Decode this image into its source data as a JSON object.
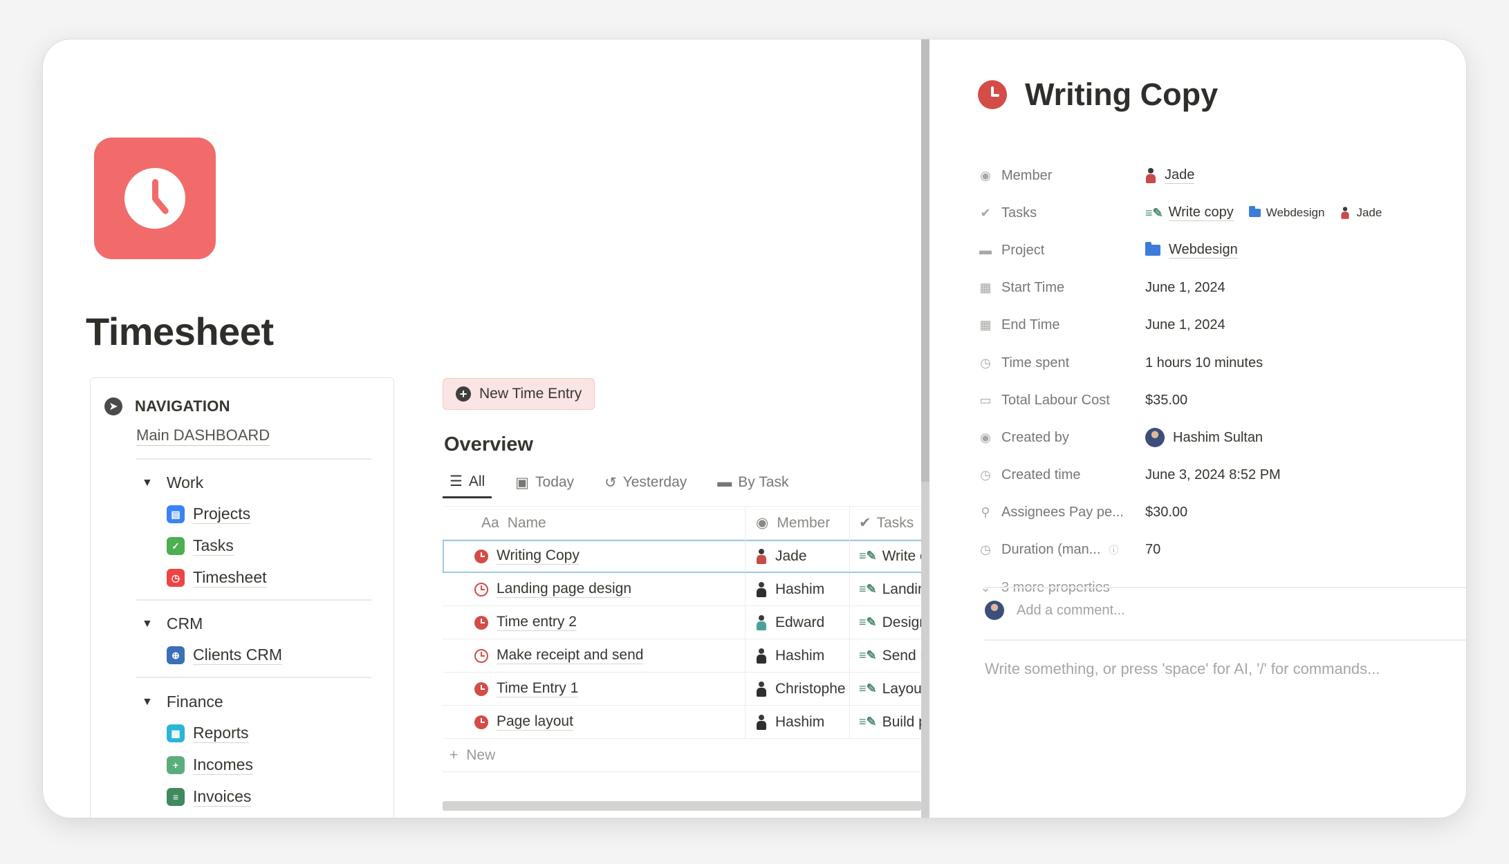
{
  "page": {
    "title": "Timesheet",
    "icon": "clock-icon",
    "icon_color": "#f26b6b"
  },
  "navigation": {
    "title": "NAVIGATION",
    "subtitle": "Main DASHBOARD",
    "groups": [
      {
        "label": "Work",
        "items": [
          {
            "label": "Projects",
            "icon": "projects-icon",
            "color": "#3b82f6"
          },
          {
            "label": "Tasks",
            "icon": "tasks-icon",
            "color": "#4caf50"
          },
          {
            "label": "Timesheet",
            "icon": "timesheet-icon",
            "color": "#ef4444"
          }
        ]
      },
      {
        "label": "CRM",
        "items": [
          {
            "label": "Clients CRM",
            "icon": "clients-icon",
            "color": "#3b6fb6"
          }
        ]
      },
      {
        "label": "Finance",
        "items": [
          {
            "label": "Reports",
            "icon": "reports-icon",
            "color": "#29b6d6"
          },
          {
            "label": "Incomes",
            "icon": "incomes-icon",
            "color": "#5aae7d"
          },
          {
            "label": "Invoices",
            "icon": "invoices-icon",
            "color": "#3f8a5e"
          }
        ]
      }
    ]
  },
  "main": {
    "new_entry_button": "New Time Entry",
    "overview_title": "Overview",
    "views": [
      {
        "label": "All",
        "icon": "list-icon",
        "active": true
      },
      {
        "label": "Today",
        "icon": "calendar-icon",
        "active": false
      },
      {
        "label": "Yesterday",
        "icon": "history-icon",
        "active": false
      },
      {
        "label": "By Task",
        "icon": "folder-icon",
        "active": false
      }
    ],
    "table": {
      "columns": [
        "Name",
        "Member",
        "Tasks"
      ],
      "name_prefix": "Aa",
      "rows": [
        {
          "name": "Writing Copy",
          "member": "Jade",
          "task": "Write c"
        },
        {
          "name": "Landing page design",
          "member": "Hashim",
          "task": "Landin"
        },
        {
          "name": "Time entry 2",
          "member": "Edward",
          "task": "Design"
        },
        {
          "name": "Make receipt and send",
          "member": "Hashim",
          "task": "Send r"
        },
        {
          "name": "Time Entry 1",
          "member": "Christophe",
          "task": "Layout"
        },
        {
          "name": "Page layout",
          "member": "Hashim",
          "task": "Build p"
        }
      ],
      "new_label": "New"
    }
  },
  "detail": {
    "title": "Writing Copy",
    "properties": {
      "member": {
        "label": "Member",
        "value": "Jade"
      },
      "tasks": {
        "label": "Tasks",
        "value": "Write copy",
        "project": "Webdesign",
        "member": "Jade"
      },
      "project": {
        "label": "Project",
        "value": "Webdesign"
      },
      "start_time": {
        "label": "Start Time",
        "value": "June 1, 2024"
      },
      "end_time": {
        "label": "End Time",
        "value": "June 1, 2024"
      },
      "time_spent": {
        "label": "Time spent",
        "value": "1 hours 10 minutes"
      },
      "labour_cost": {
        "label": "Total Labour Cost",
        "value": "$35.00"
      },
      "created_by": {
        "label": "Created by",
        "value": "Hashim Sultan"
      },
      "created_time": {
        "label": "Created time",
        "value": "June 3, 2024 8:52 PM"
      },
      "assignees_pay": {
        "label": "Assignees Pay pe...",
        "value": "$30.00"
      },
      "duration": {
        "label": "Duration (man...",
        "value": "70"
      }
    },
    "more_properties": "3 more properties",
    "comment_placeholder": "Add a comment...",
    "body_placeholder": "Write something, or press 'space' for AI, '/' for commands..."
  }
}
